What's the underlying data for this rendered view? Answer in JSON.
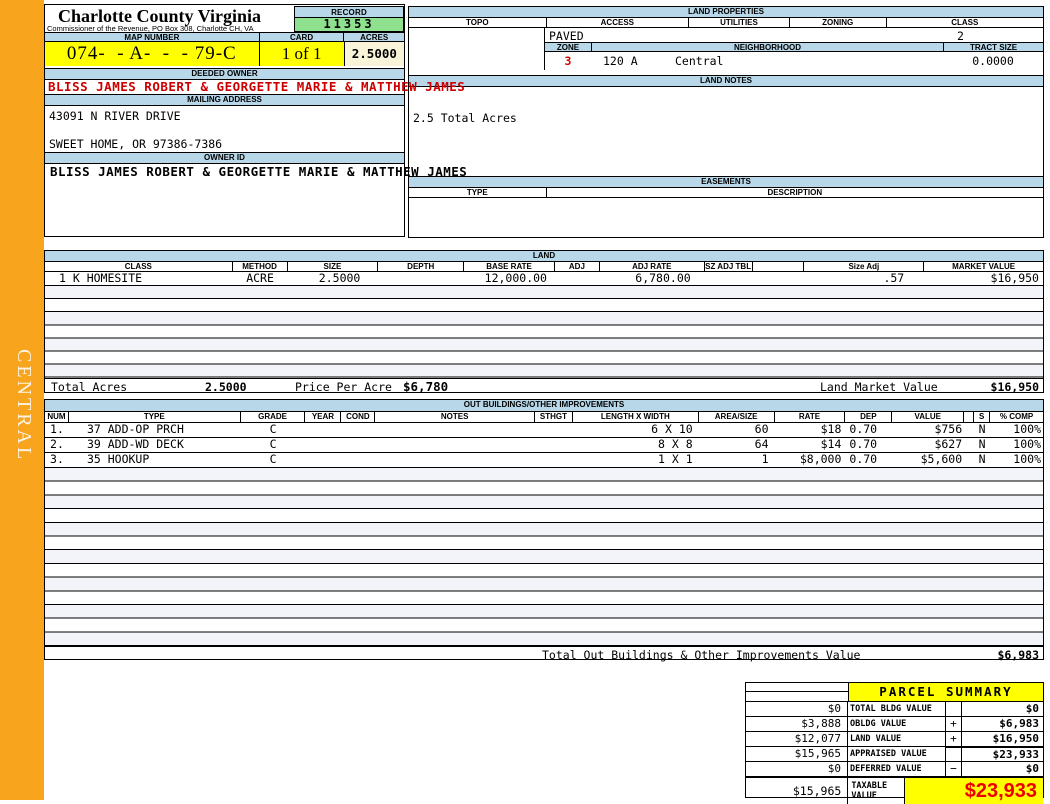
{
  "sidebar": {
    "district": "CENTRAL"
  },
  "header": {
    "county_title": "Charlotte County Virginia",
    "county_subtitle": "Commissioner of the Revenue, PO Box 308, Charlotte CH, VA",
    "record_label": "RECORD",
    "record_value": "11353",
    "map_number_label": "MAP NUMBER",
    "map_number_value": "074-  - A-  -  - 79-C",
    "card_label": "CARD",
    "card_value": "1 of 1",
    "acres_label": "ACRES",
    "acres_value": "2.5000"
  },
  "owner": {
    "deeded_owner_label": "DEEDED OWNER",
    "deeded_owner": "BLISS JAMES ROBERT & GEORGETTE MARIE & MATTHEW JAMES",
    "mailing_label": "MAILING ADDRESS",
    "address_line1": "43091 N RIVER DRIVE",
    "address_line2": "SWEET HOME, OR 97386-7386",
    "owner_id_label": "OWNER ID",
    "owner_id": "BLISS JAMES ROBERT & GEORGETTE MARIE & MATTHEW JAMES"
  },
  "land_properties": {
    "title": "LAND PROPERTIES",
    "headers": [
      "TOPO",
      "ACCESS",
      "UTILITIES",
      "ZONING",
      "CLASS"
    ],
    "access_value": "PAVED",
    "class_value": "2",
    "zone_label": "ZONE",
    "zone_value": "3",
    "neighborhood_label": "NEIGHBORHOOD",
    "neighborhood_code": "120 A",
    "neighborhood_name": "Central",
    "tract_label": "TRACT SIZE",
    "tract_value": "0.0000"
  },
  "land_notes": {
    "title": "LAND NOTES",
    "note": "2.5 Total Acres"
  },
  "easements": {
    "title": "EASEMENTS",
    "type_label": "TYPE",
    "desc_label": "DESCRIPTION"
  },
  "land": {
    "title": "LAND",
    "headers": [
      "CLASS",
      "METHOD",
      "SIZE",
      "DEPTH",
      "BASE RATE",
      "ADJ",
      "ADJ RATE",
      "SZ ADJ TBL",
      "",
      "Size Adj",
      "MARKET VALUE"
    ],
    "row": {
      "class": "1 K HOMESITE",
      "method": "ACRE",
      "size": "2.5000",
      "depth": "",
      "base_rate": "12,000.00",
      "adj": "",
      "adj_rate": "6,780.00",
      "sz_adj_tbl": "",
      "size_adj": ".57",
      "market_value": "$16,950"
    },
    "totals": {
      "total_acres_label": "Total Acres",
      "total_acres_value": "2.5000",
      "price_per_acre_label": "Price Per Acre",
      "price_per_acre_value": "$6,780",
      "land_market_label": "Land Market Value",
      "land_market_value": "$16,950"
    }
  },
  "out_buildings": {
    "title": "OUT BUILDINGS/OTHER IMPROVEMENTS",
    "headers": [
      "NUM",
      "TYPE",
      "GRADE",
      "YEAR",
      "COND",
      "NOTES",
      "STHGT",
      "LENGTH X WIDTH",
      "AREA/SIZE",
      "RATE",
      "DEP",
      "VALUE",
      "S",
      "% COMP"
    ],
    "rows": [
      {
        "num": "1.",
        "type": "37 ADD-OP PRCH",
        "grade": "C",
        "dims": "6 X 10",
        "area": "60",
        "rate": "$18",
        "dep": "0.70",
        "value": "$756",
        "s": "N",
        "comp": "100%"
      },
      {
        "num": "2.",
        "type": "39 ADD-WD DECK",
        "grade": "C",
        "dims": "8 X 8",
        "area": "64",
        "rate": "$14",
        "dep": "0.70",
        "value": "$627",
        "s": "N",
        "comp": "100%"
      },
      {
        "num": "3.",
        "type": "35 HOOKUP",
        "grade": "C",
        "dims": "1 X 1",
        "area": "1",
        "rate": "$8,000",
        "dep": "0.70",
        "value": "$5,600",
        "s": "N",
        "comp": "100%"
      }
    ],
    "total_label": "Total Out Buildings & Other Improvements Value",
    "total_value": "$6,983"
  },
  "parcel_summary": {
    "title": "PARCEL SUMMARY",
    "rows": [
      {
        "prior": "$0",
        "label": "TOTAL BLDG VALUE",
        "op": "",
        "value": "$0"
      },
      {
        "prior": "$3,888",
        "label": "OBLDG VALUE",
        "op": "+",
        "value": "$6,983"
      },
      {
        "prior": "$12,077",
        "label": "LAND VALUE",
        "op": "+",
        "value": "$16,950"
      },
      {
        "prior": "$15,965",
        "label": "APPRAISED VALUE",
        "op": "",
        "value": "$23,933"
      },
      {
        "prior": "$0",
        "label": "DEFERRED VALUE",
        "op": "−",
        "value": "$0"
      }
    ],
    "taxable": {
      "prior": "$15,965",
      "label": "TAXABLE VALUE",
      "value": "$23,933"
    }
  },
  "colors": {
    "accent_orange": "#f8a41c",
    "header_blue": "#b8d7e8",
    "record_green": "#8fe08f",
    "highlight_yellow": "#ffff00",
    "acres_cream": "#f8f3d9",
    "stripe_lavender": "#f3f3fa",
    "alert_red": "#cc0000",
    "taxable_red": "#ee0000"
  }
}
